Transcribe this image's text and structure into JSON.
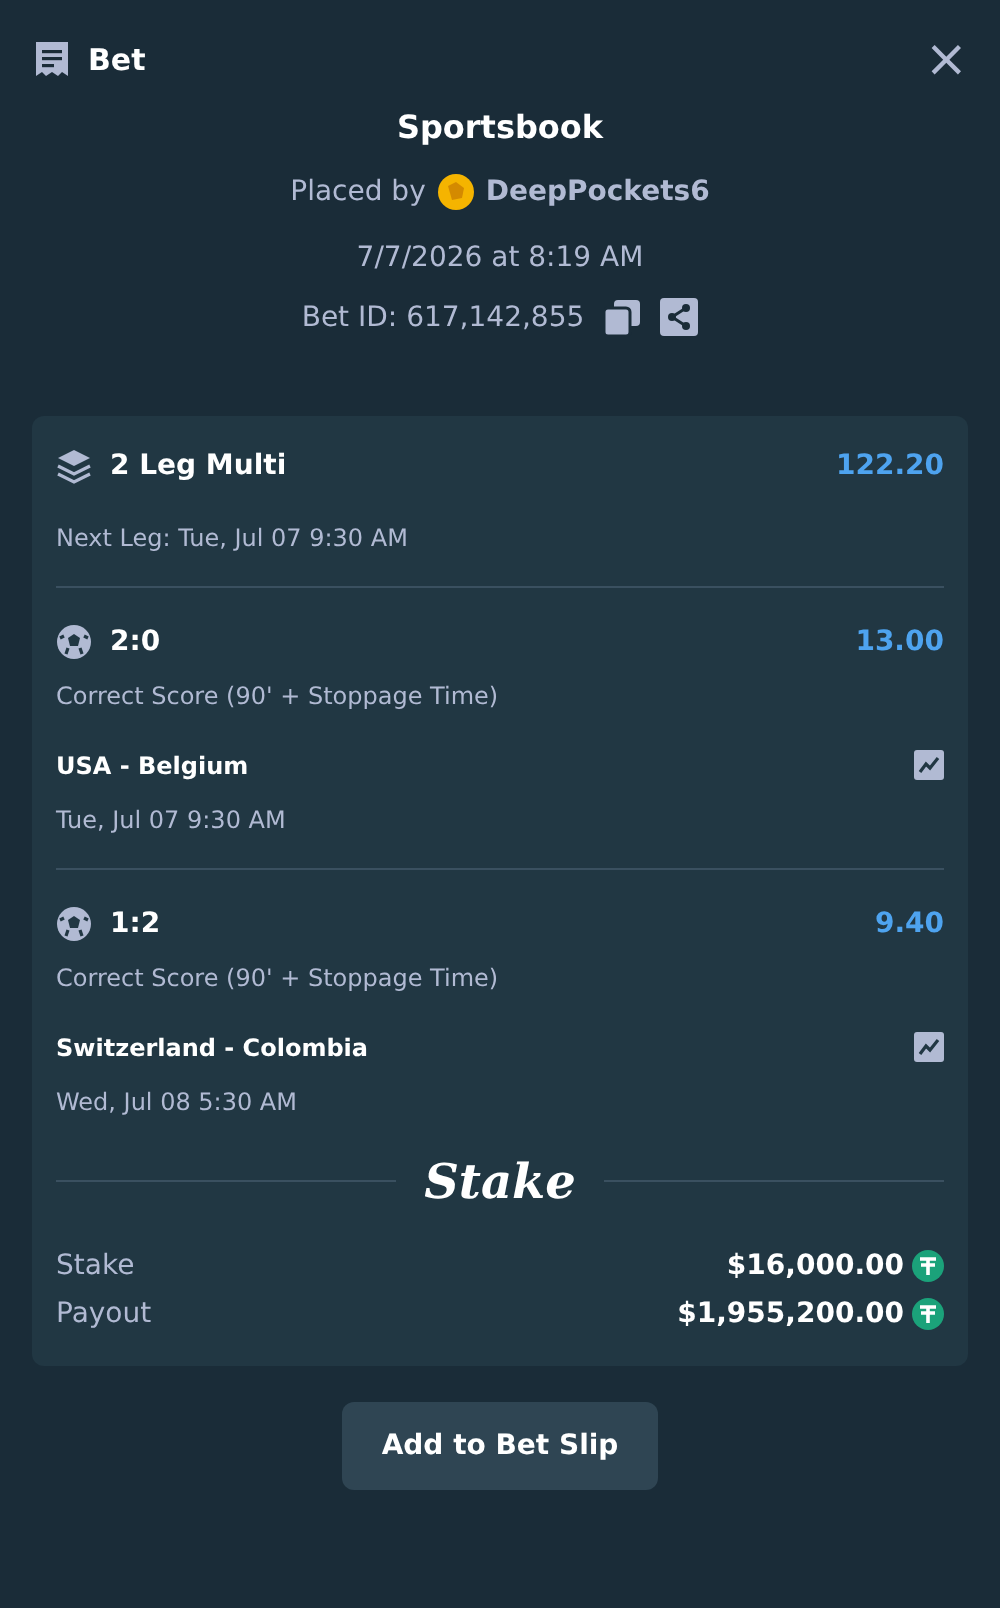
{
  "header": {
    "title": "Bet",
    "close": "×"
  },
  "summary": {
    "source": "Sportsbook",
    "placed_by_label": "Placed by",
    "user": "DeepPockets6",
    "date": "7/7/2026 at 8:19 AM",
    "bet_id": "Bet ID: 617,142,855"
  },
  "multi": {
    "title": "2 Leg Multi",
    "odds": "122.20",
    "next_leg": "Next Leg: Tue, Jul 07 9:30 AM"
  },
  "legs": [
    {
      "outcome": "2:0",
      "odds": "13.00",
      "market": "Correct Score (90' + Stoppage Time)",
      "match": "USA - Belgium",
      "time": "Tue, Jul 07  9:30 AM"
    },
    {
      "outcome": "1:2",
      "odds": "9.40",
      "market": "Correct Score (90' + Stoppage Time)",
      "match": "Switzerland - Colombia",
      "time": "Wed, Jul 08  5:30 AM"
    }
  ],
  "logo": "Stake",
  "totals": [
    {
      "label": "Stake",
      "amount": "$16,000.00"
    },
    {
      "label": "Payout",
      "amount": "$1,955,200.00"
    }
  ],
  "button": "Add to Bet Slip"
}
